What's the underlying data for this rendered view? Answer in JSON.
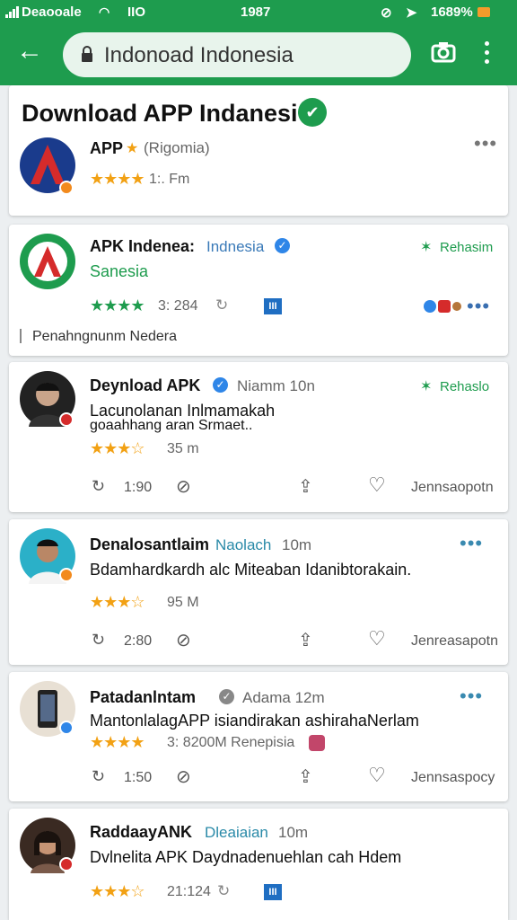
{
  "status_bar": {
    "carrier": "Deaooale",
    "net": "IIO",
    "time": "1987",
    "battery": "1689%"
  },
  "toolbar": {
    "url": "Indonoad Indonesia"
  },
  "page_title": "Download APP Indanesi",
  "cards": [
    {
      "title": "APP",
      "subtitle": "(Rigomia)",
      "rating_text": "1:. Fm"
    },
    {
      "title": "APK Indenea:",
      "subtitle": "Indnesia",
      "badge_text": "Rehasim",
      "subtitle2": "Sanesia",
      "rating_text": "3: 284",
      "footer": "Penahngnunm  Nedera"
    },
    {
      "title": "Deynload APK",
      "subtitle": "Niamm 10n",
      "badge_text": "Rehaslo",
      "desc1": "Lacunolanan Inlmamakah",
      "desc2": "goaahhang aran Srmaet..",
      "rating_text": "35 m",
      "comments": "1:90",
      "share_label": "Jennsaopotn"
    },
    {
      "title": "Denalosantlaim",
      "subtitle": "Naolach",
      "time": "10m",
      "desc1": "Bdamhardkardh alc Miteaban Idanibtorakain.",
      "rating_text": "95 M",
      "comments": "2:80",
      "share_label": "Jenreasapotn"
    },
    {
      "title": "Patadanlntam",
      "subtitle": "Adama 12m",
      "desc1": "MantonlalagAPP isiandirakan ashirahaNerlam",
      "rating_text": "3: 8200M Renepisia",
      "comments": "1:50",
      "share_label": "Jennsaspocy"
    },
    {
      "title": "RaddaayANK",
      "subtitle": "Dleaiaian",
      "time": "10m",
      "desc1": "Dvlnelita APK Daydnadenuehlan cah Hdem",
      "rating_text": "21:124"
    }
  ],
  "colors": {
    "brand": "#1e9c4e",
    "accent_blue": "#2f86e8",
    "star": "#f2a114"
  },
  "stars": {
    "gold": "★★★★",
    "gold3": "★★★☆",
    "green": "★★★★"
  }
}
